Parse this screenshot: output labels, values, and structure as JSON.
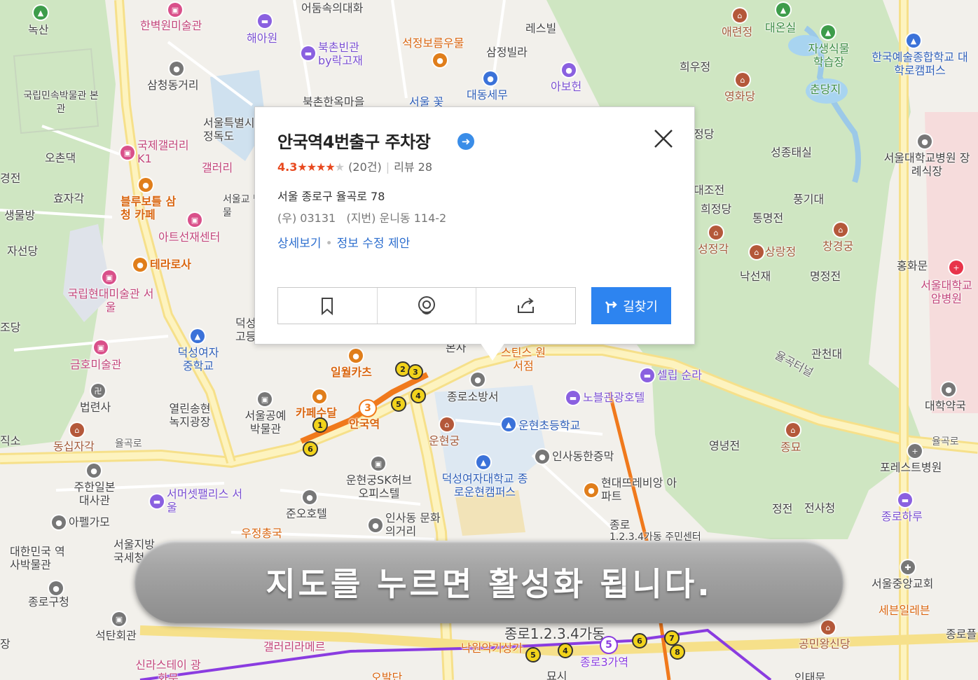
{
  "popup": {
    "title": "안국역4번출구 주차장",
    "rating_score": "4.3",
    "rating_stars": "★★★★",
    "rating_half": "★",
    "rating_count": "(20건)",
    "review": "리뷰 28",
    "rating_value": 4.3,
    "address_road": "서울 종로구 율곡로 78",
    "address_zip": "(우) 03131",
    "address_lot": "(지번) 운니동 114-2",
    "link_detail": "상세보기",
    "link_edit": "정보 수정 제안",
    "route_label": "길찾기",
    "actions": [
      "bookmark-icon",
      "roadview-icon",
      "share-icon"
    ],
    "title_icon": "arrow-right-circle-icon",
    "close_icon": "close-icon"
  },
  "banner": {
    "text": "지도를 누르면 활성화 됩니다."
  },
  "map_labels": [
    "어둠속의대화",
    "녹산",
    "한벽원미술관",
    "해아원",
    "북촌빈관 by락고재",
    "석정보름우물",
    "레스빌",
    "삼정빌라",
    "애련정",
    "대온실",
    "자생식물 학습장",
    "한국예술종합학교 대학로캠퍼스",
    "국립민속박물관 본관",
    "삼청동거리",
    "북촌한옥마을",
    "서울 꽃",
    "대동세무",
    "아보헌",
    "희우정",
    "영화당",
    "춘당지",
    "서울특별시 정독도",
    "국제갤러리 K1",
    "갤러리",
    "오촌댁",
    "경전",
    "효자각",
    "생물방",
    "블루보틀 삼청 카페",
    "서울교 박물",
    "아트선재센터",
    "정당",
    "성종태실",
    "서울대학교병원 장례식장",
    "자선당",
    "테라로사",
    "대조전",
    "희정당",
    "통명전",
    "풍기대",
    "성정각",
    "상랑정",
    "창경궁",
    "국립현대미술관 서울",
    "덕성 고등",
    "낙선재",
    "명정전",
    "홍화문",
    "서울대학교 암병원",
    "조당",
    "덕성여자 중학교",
    "금호미술관",
    "일월카츠",
    "본사",
    "스틴스 원서점",
    "율곡터널",
    "관천대",
    "셀립 순라",
    "대학약국",
    "법련사",
    "열린송현 녹지광장",
    "서울공예 박물관",
    "카페수달",
    "안국역",
    "종로소방서",
    "노블관광호텔",
    "운현궁",
    "운현초등학교",
    "영녕전",
    "종묘",
    "율곡로",
    "직소",
    "동십자각",
    "율곡로",
    "인사동한증막",
    "포레스트병원",
    "주한일본 대사관",
    "서머셋팰리스 서울",
    "운현궁SK허브 오피스텔",
    "덕성여자대학교 종로운현캠퍼스",
    "현대뜨레비앙 아파트",
    "정전",
    "전사청",
    "종로하루",
    "아펠가모",
    "준오호텔",
    "인사동 문화의거리",
    "우정총국",
    "종로",
    "1.2.3.4가동 주민센터",
    "대한민국 역사박물관",
    "서울지방 국세청",
    "서울중앙교회",
    "종로구청",
    "세븐일레븐",
    "석탄회관",
    "갤러리라메르",
    "낙원악기상가",
    "종로1.2.3.4가동",
    "공민왕신당",
    "종로3가역",
    "신라스테이 광화문",
    "종로플",
    "장",
    "오발단",
    "인태문",
    "묘시"
  ]
}
